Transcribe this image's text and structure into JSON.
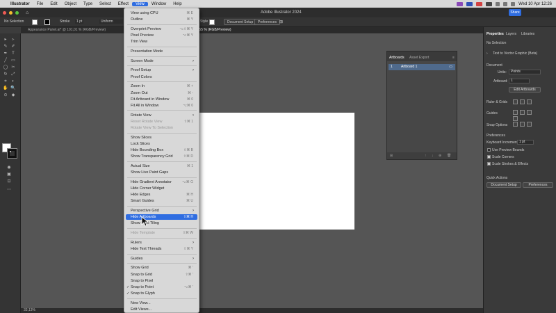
{
  "macbar": {
    "apple": "",
    "app": "Illustrator",
    "menus": [
      "File",
      "Edit",
      "Object",
      "Type",
      "Select",
      "Effect",
      "View",
      "Window",
      "Help"
    ],
    "clock": "Wed 10 Apr  12:26"
  },
  "window": {
    "title": "Adobe Illustrator 2024",
    "share_label": "Share",
    "home_icon": "home-icon"
  },
  "control_bar": {
    "selection": "No Selection",
    "stroke_label": "Stroke",
    "stroke_value": "1 pt",
    "profile": "Uniform",
    "style_label": "Style",
    "document_setup": "Document Setup",
    "preferences": "Preferences"
  },
  "tabs": [
    "Appearance Panel.ai* @ 101,01 % (RGB/Preview)",
    ".55 % (RGB/Preview)"
  ],
  "status": {
    "zoom": "33,13%"
  },
  "artboards_panel": {
    "tabs": [
      "Artboards",
      "Asset Export"
    ],
    "rows": [
      {
        "num": "1",
        "name": "Artboard 1"
      }
    ]
  },
  "properties": {
    "tabs": [
      "Properties",
      "Layers",
      "Libraries"
    ],
    "no_selection": "No Selection",
    "text_to_vector": "Text to Vector Graphic (Beta)",
    "document_label": "Document",
    "units_label": "Units:",
    "units_value": "Points",
    "artboard_label": "Artboard:",
    "artboard_value": "1",
    "edit_artboards": "Edit Artboards",
    "rulers_grids": "Ruler & Grids",
    "guides": "Guides",
    "snap_options": "Snap Options",
    "preferences_label": "Preferences",
    "keyboard_increment_label": "Keyboard Increment:",
    "keyboard_increment_value": "1 pt",
    "use_preview_bounds": "Use Preview Bounds",
    "scale_corners": "Scale Corners",
    "scale_strokes": "Scale Strokes & Effects",
    "quick_actions": "Quick Actions",
    "document_setup": "Document Setup",
    "preferences_btn": "Preferences"
  },
  "view_menu": {
    "items": [
      {
        "label": "View using CPU",
        "shortcut": "⌘ E"
      },
      {
        "label": "Outline",
        "shortcut": "⌘ Y"
      },
      {
        "sep": true
      },
      {
        "label": "Overprint Preview",
        "shortcut": "⌥⇧⌘ Y"
      },
      {
        "label": "Pixel Preview",
        "shortcut": "⌥⌘ Y"
      },
      {
        "label": "Trim View"
      },
      {
        "sep": true
      },
      {
        "label": "Presentation Mode"
      },
      {
        "sep": true
      },
      {
        "label": "Screen Mode",
        "arrow": true
      },
      {
        "sep": true
      },
      {
        "label": "Proof Setup",
        "arrow": true
      },
      {
        "label": "Proof Colors"
      },
      {
        "sep": true
      },
      {
        "label": "Zoom In",
        "shortcut": "⌘ +"
      },
      {
        "label": "Zoom Out",
        "shortcut": "⌘ -"
      },
      {
        "label": "Fit Artboard in Window",
        "shortcut": "⌘ 0"
      },
      {
        "label": "Fit All in Window",
        "shortcut": "⌥⌘ 0"
      },
      {
        "sep": true
      },
      {
        "label": "Rotate View",
        "arrow": true
      },
      {
        "label": "Reset Rotate View",
        "shortcut": "⇧⌘ 1",
        "disabled": true
      },
      {
        "label": "Rotate View To Selection",
        "disabled": true
      },
      {
        "sep": true
      },
      {
        "label": "Show Slices"
      },
      {
        "label": "Lock Slices"
      },
      {
        "label": "Hide Bounding Box",
        "shortcut": "⇧⌘ B"
      },
      {
        "label": "Show Transparency Grid",
        "shortcut": "⇧⌘ D"
      },
      {
        "sep": true
      },
      {
        "label": "Actual Size",
        "shortcut": "⌘ 1"
      },
      {
        "label": "Show Live Paint Gaps"
      },
      {
        "sep": true
      },
      {
        "label": "Hide Gradient Annotator",
        "shortcut": "⌥⌘ G"
      },
      {
        "label": "Hide Corner Widget"
      },
      {
        "label": "Hide Edges",
        "shortcut": "⌘ H"
      },
      {
        "label": "Smart Guides",
        "shortcut": "⌘ U"
      },
      {
        "sep": true
      },
      {
        "label": "Perspective Grid",
        "arrow": true
      },
      {
        "label": "Hide Artboards",
        "shortcut": "⇧⌘ H",
        "highlight": true
      },
      {
        "label": "Show Print Tiling"
      },
      {
        "sep": true
      },
      {
        "label": "Hide Template",
        "shortcut": "⇧⌘ W",
        "disabled": true
      },
      {
        "sep": true
      },
      {
        "label": "Rulers",
        "arrow": true
      },
      {
        "label": "Hide Text Threads",
        "shortcut": "⇧⌘ Y"
      },
      {
        "sep": true
      },
      {
        "label": "Guides",
        "arrow": true
      },
      {
        "sep": true
      },
      {
        "label": "Show Grid",
        "shortcut": "⌘ '"
      },
      {
        "label": "Snap to Grid",
        "shortcut": "⇧⌘ '"
      },
      {
        "label": "Snap to Pixel"
      },
      {
        "label": "Snap to Point",
        "shortcut": "⌥⌘ '",
        "checked": true
      },
      {
        "label": "Snap to Glyph",
        "checked": true
      },
      {
        "sep": true
      },
      {
        "label": "New View..."
      },
      {
        "label": "Edit Views..."
      }
    ]
  }
}
